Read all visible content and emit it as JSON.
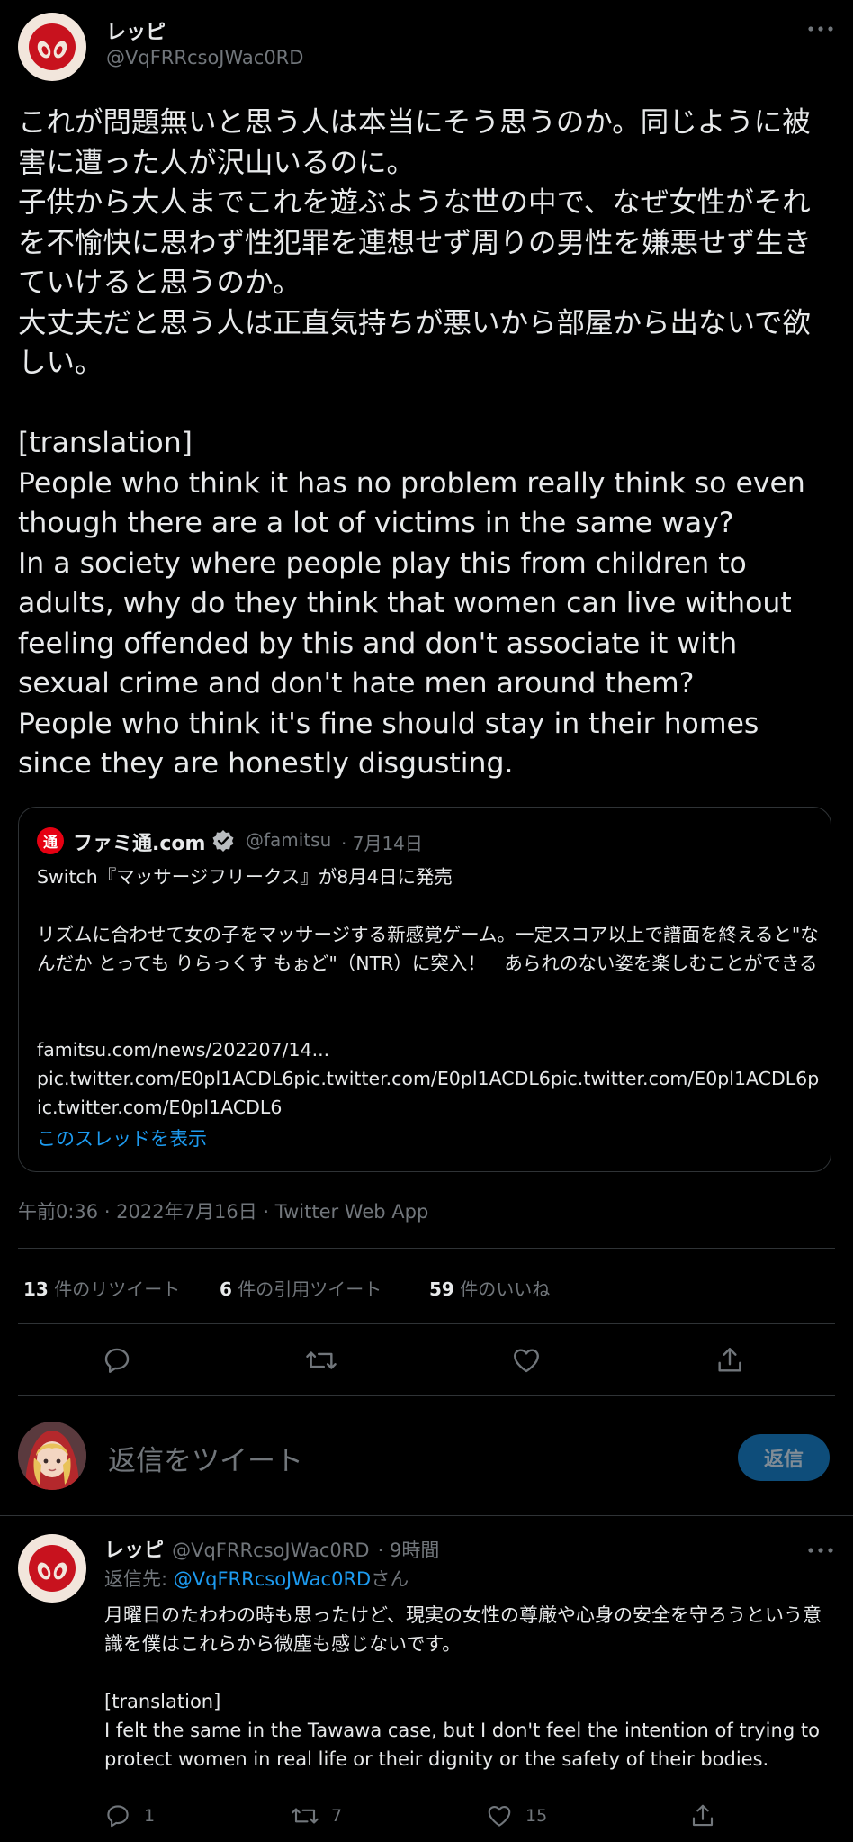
{
  "main_tweet": {
    "author_name": "レッピ",
    "author_handle": "@VqFRRcsoJWac0RD",
    "body": "これが問題無いと思う人は本当にそう思うのか。同じように被害に遭った人が沢山いるのに。\n子供から大人までこれを遊ぶような世の中で、なぜ女性がそれを不愉快に思わず性犯罪を連想せず周りの男性を嫌悪せず生きていけると思うのか。\n大丈夫だと思う人は正直気持ちが悪いから部屋から出ないで欲しい。\n\n[translation]\nPeople who think it has no problem really think so even though there are a lot of victims in the same way?\nIn a society where people play this from children to adults, why do they think that women can live without feeling offended by this and don't associate it with sexual crime and don't hate men around them?\nPeople who think it's fine should stay in their homes since they are honestly disgusting.",
    "timestamp": "午前0:36 · 2022年7月16日 · Twitter Web App"
  },
  "quoted_tweet": {
    "logo_char": "通",
    "author_name": "ファミ通.com",
    "author_handle": "@famitsu",
    "date": "· 7月14日",
    "line1": "Switch『マッサージフリークス』が8月4日に発売",
    "line2": "リズムに合わせて女の子をマッサージする新感覚ゲーム。一定スコア以上で譜面を終えると\"なんだか とっても りらっくす もぉど\"（NTR）に突入！　あられのない姿を楽しむことができる",
    "line3": "famitsu.com/news/202207/14...\npic.twitter.com/E0pl1ACDL6pic.twitter.com/E0pl1ACDL6pic.twitter.com/E0pl1ACDL6pic.twitter.com/E0pl1ACDL6",
    "show_thread": "このスレッドを表示"
  },
  "stats": {
    "retweets_count": "13",
    "retweets_label": "件のリツイート",
    "quotes_count": "6",
    "quotes_label": "件の引用ツイート",
    "likes_count": "59",
    "likes_label": "件のいいね"
  },
  "compose": {
    "placeholder": "返信をツイート",
    "button": "返信"
  },
  "reply": {
    "author_name": "レッピ",
    "author_handle": "@VqFRRcsoJWac0RD",
    "time": "· 9時間",
    "replying_prefix": "返信先: ",
    "replying_handle": "@VqFRRcsoJWac0RD",
    "replying_suffix": "さん",
    "body": "月曜日のたわわの時も思ったけど、現実の女性の尊厳や心身の安全を守ろうという意識を僕はこれらから微塵も感じないです。\n\n[translation]\nI felt the same in the Tawawa case, but I don't feel the intention of trying to protect women in real life or their dignity or the safety of their bodies.",
    "reply_count": "1",
    "retweet_count": "7",
    "like_count": "15"
  },
  "colors": {
    "accent": "#1d9bf0",
    "muted": "#71767b",
    "famitsu_red": "#e60012",
    "verified": "#b9bcbf"
  }
}
